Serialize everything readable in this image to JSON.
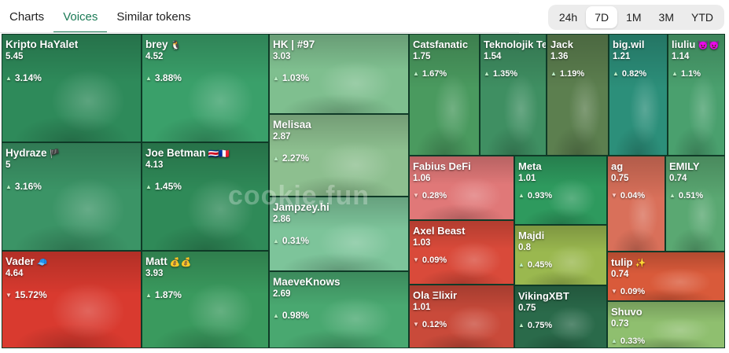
{
  "tabs": [
    {
      "label": "Charts",
      "active": false
    },
    {
      "label": "Voices",
      "active": true
    },
    {
      "label": "Similar tokens",
      "active": false
    }
  ],
  "time_range": {
    "options": [
      "24h",
      "7D",
      "1M",
      "3M",
      "YTD"
    ],
    "selected": "7D"
  },
  "watermark": "cookie.fun",
  "colors": {
    "up": "#2f9a62",
    "down": "#d93a2f",
    "accent": "#1a7a55"
  },
  "voices": [
    {
      "name": "Kripto HaYalet",
      "badge": "",
      "value": "5.45",
      "change": "3.14%",
      "dir": "up",
      "color": "#2e8a5a",
      "avatar_icon": "ghost-avatar-icon"
    },
    {
      "name": "brey",
      "badge": "🐧",
      "value": "4.52",
      "change": "3.88%",
      "dir": "up",
      "color": "#3aa06a",
      "avatar_icon": "capybara-avatar-icon"
    },
    {
      "name": "HK | #97",
      "badge": "",
      "value": "3.03",
      "change": "1.03%",
      "dir": "up",
      "color": "#7fbf8f",
      "avatar_icon": "pepe-avatar-icon"
    },
    {
      "name": "Catsfanatic",
      "badge": "",
      "value": "1.75",
      "change": "1.67%",
      "dir": "up",
      "color": "#4a9a5f",
      "avatar_icon": "lion-avatar-icon"
    },
    {
      "name": "Teknolojik Tebeşir",
      "badge": "🥷",
      "value": "1.54",
      "change": "1.35%",
      "dir": "up",
      "color": "#3f8f62",
      "avatar_icon": "robot-avatar-icon"
    },
    {
      "name": "Jack",
      "badge": "",
      "value": "1.36",
      "change": "1.19%",
      "dir": "up",
      "color": "#5c7f4f",
      "avatar_icon": "anime-avatar-icon"
    },
    {
      "name": "big.wil",
      "badge": "",
      "value": "1.21",
      "change": "0.82%",
      "dir": "up",
      "color": "#2c8f7a",
      "avatar_icon": "helmet-avatar-icon"
    },
    {
      "name": "liuliu",
      "badge": "😈😈",
      "value": "1.14",
      "change": "1.1%",
      "dir": "up",
      "color": "#4aa06e",
      "avatar_icon": "girl-avatar-icon"
    },
    {
      "name": "Hydraze",
      "badge": "🏴",
      "value": "5",
      "change": "3.16%",
      "dir": "up",
      "color": "#3b9466",
      "avatar_icon": "face-avatar-icon"
    },
    {
      "name": "Joe Betman",
      "badge": "🇨🇷🇫🇷",
      "value": "4.13",
      "change": "1.45%",
      "dir": "up",
      "color": "#2f8a58",
      "avatar_icon": "rabbit-avatar-icon"
    },
    {
      "name": "Melisaa",
      "badge": "",
      "value": "2.87",
      "change": "2.27%",
      "dir": "up",
      "color": "#8dbf8f",
      "avatar_icon": "woman-avatar-icon"
    },
    {
      "name": "Jampzey.hi",
      "badge": "",
      "value": "2.86",
      "change": "0.31%",
      "dir": "up",
      "color": "#7dc49a",
      "avatar_icon": "penguin-avatar-icon"
    },
    {
      "name": "Fabius DeFi",
      "badge": "",
      "value": "1.06",
      "change": "0.28%",
      "dir": "down",
      "color": "#e07878",
      "avatar_icon": "troll-avatar-icon"
    },
    {
      "name": "Meta",
      "badge": "",
      "value": "1.01",
      "change": "0.93%",
      "dir": "up",
      "color": "#2e9a5e",
      "avatar_icon": "alien-avatar-icon"
    },
    {
      "name": "ag",
      "badge": "",
      "value": "0.75",
      "change": "0.04%",
      "dir": "down",
      "color": "#d9705a",
      "avatar_icon": "bearded-avatar-icon"
    },
    {
      "name": "EMILY",
      "badge": "",
      "value": "0.74",
      "change": "0.51%",
      "dir": "up",
      "color": "#5aa872",
      "avatar_icon": "cat-girl-avatar-icon"
    },
    {
      "name": "Axel Beast",
      "badge": "",
      "value": "1.03",
      "change": "0.09%",
      "dir": "down",
      "color": "#d94a3a",
      "avatar_icon": "pirate-avatar-icon"
    },
    {
      "name": "Majdi",
      "badge": "",
      "value": "0.8",
      "change": "0.45%",
      "dir": "up",
      "color": "#9ab84f",
      "avatar_icon": "sunglasses-avatar-icon"
    },
    {
      "name": "Vader",
      "badge": "🧢",
      "value": "4.64",
      "change": "15.72%",
      "dir": "down",
      "color": "#d93a2f",
      "avatar_icon": "cap-man-avatar-icon"
    },
    {
      "name": "Matt",
      "badge": "💰💰",
      "value": "3.93",
      "change": "1.87%",
      "dir": "up",
      "color": "#3a9a5e",
      "avatar_icon": "ape-avatar-icon"
    },
    {
      "name": "MaeveKnows",
      "badge": "",
      "value": "2.69",
      "change": "0.98%",
      "dir": "up",
      "color": "#49a870",
      "avatar_icon": "sword-avatar-icon"
    },
    {
      "name": "tulip",
      "badge": "✨",
      "value": "0.74",
      "change": "0.09%",
      "dir": "down",
      "color": "#d95a3a",
      "avatar_icon": "redhead-avatar-icon"
    },
    {
      "name": "Ola Ξlixir",
      "badge": "",
      "value": "1.01",
      "change": "0.12%",
      "dir": "down",
      "color": "#c94a3a",
      "avatar_icon": "samurai-avatar-icon"
    },
    {
      "name": "VikingXBT",
      "badge": "",
      "value": "0.75",
      "change": "0.75%",
      "dir": "up",
      "color": "#2a6a4a",
      "avatar_icon": "viking-avatar-icon"
    },
    {
      "name": "Shuvo",
      "badge": "",
      "value": "0.73",
      "change": "0.33%",
      "dir": "up",
      "color": "#8fbf6f",
      "avatar_icon": "blonde-avatar-icon"
    }
  ]
}
